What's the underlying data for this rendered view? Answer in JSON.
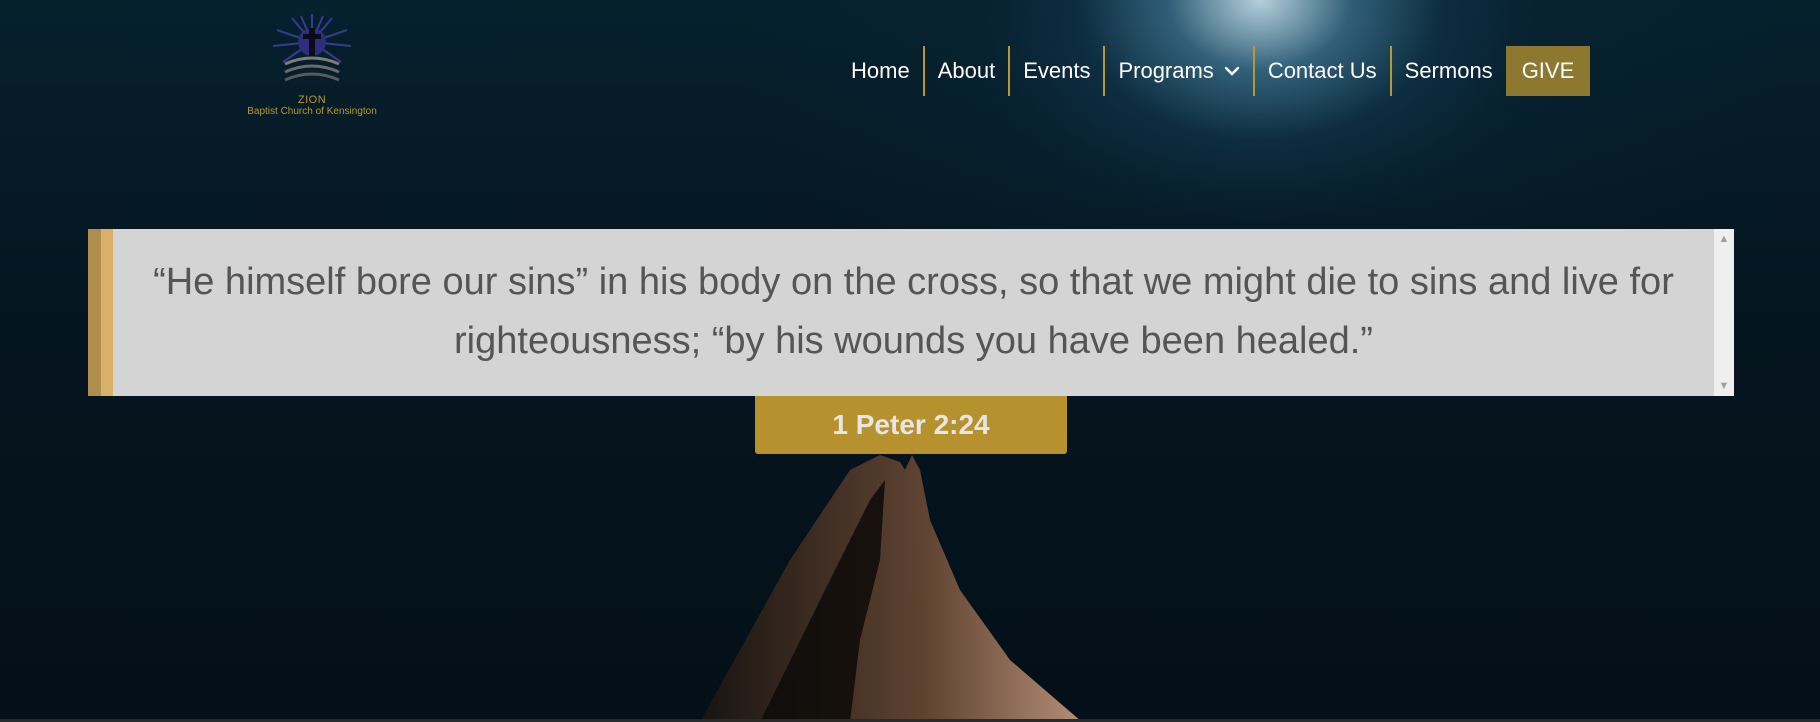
{
  "logo": {
    "name": "ZION",
    "subtitle": "Baptist Church of Kensington",
    "icon": "cross-sunburst-icon"
  },
  "nav": {
    "items": [
      {
        "label": "Home"
      },
      {
        "label": "About"
      },
      {
        "label": "Events"
      },
      {
        "label": "Programs",
        "has_dropdown": true
      },
      {
        "label": "Contact Us"
      },
      {
        "label": "Sermons"
      }
    ],
    "give_label": "GIVE"
  },
  "hero": {
    "quote": "“He himself bore our sins” in his body on the cross, so that we might die to sins and live for righteousness; “by his wounds you have been healed.”",
    "reference": "1 Peter 2:24"
  },
  "colors": {
    "gold": "#b6922f",
    "give_bg": "#8d7830",
    "quote_bg": "#d4d4d4",
    "quote_text": "#555555"
  }
}
